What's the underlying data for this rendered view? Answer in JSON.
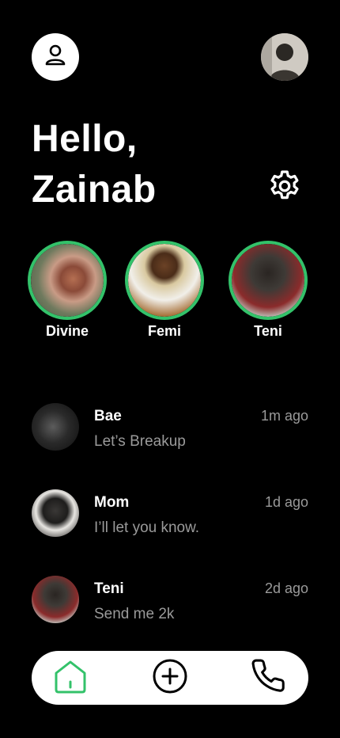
{
  "header": {
    "greeting_line1": "Hello,",
    "greeting_line2": "Zainab"
  },
  "icons": {
    "profile": "user-icon",
    "settings": "gear-icon",
    "home": "home-icon",
    "add": "plus-circle-icon",
    "call": "phone-icon"
  },
  "stories": [
    {
      "name": "Divine"
    },
    {
      "name": "Femi"
    },
    {
      "name": "Teni"
    }
  ],
  "chats": [
    {
      "name": "Bae",
      "message": "Let’s Breakup",
      "time": "1m ago"
    },
    {
      "name": "Mom",
      "message": "I’ll let you know.",
      "time": "1d ago"
    },
    {
      "name": "Teni",
      "message": "Send me 2k",
      "time": "2d ago"
    }
  ],
  "colors": {
    "background": "#000000",
    "accent": "#33c26a",
    "muted_text": "#9a9a9a"
  }
}
